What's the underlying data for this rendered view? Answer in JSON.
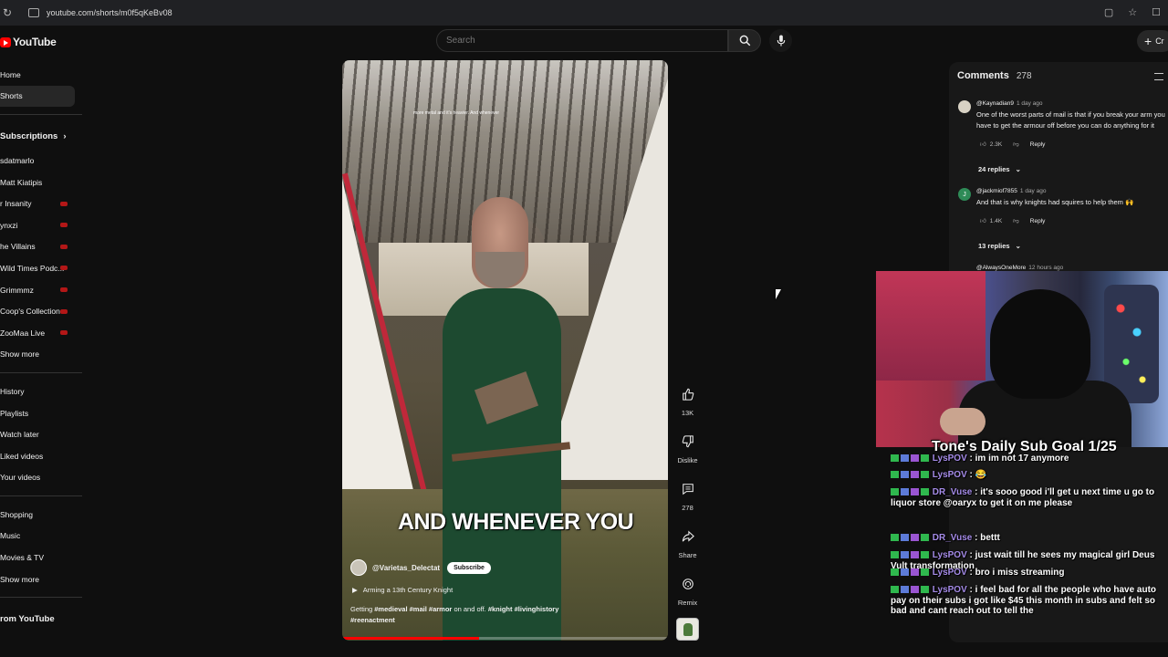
{
  "browser": {
    "url": "youtube.com/shorts/m0f5qKeBv08"
  },
  "topbar": {
    "logo_text": "YouTube",
    "search_placeholder": "Search",
    "create_label": "Cr"
  },
  "sidebar": {
    "main": [
      {
        "label": "Home",
        "active": false
      },
      {
        "label": "Shorts",
        "active": true
      }
    ],
    "subscriptions_header": "Subscriptions",
    "subscriptions": [
      {
        "label": "sdatmarlo",
        "live": false
      },
      {
        "label": "Matt Kiatipis",
        "live": false
      },
      {
        "label": "r Insanity",
        "live": true
      },
      {
        "label": "ynxzi",
        "live": true
      },
      {
        "label": "he Villains",
        "live": true
      },
      {
        "label": "Wild Times Podc...",
        "live": true
      },
      {
        "label": "Grimmmz",
        "live": true
      },
      {
        "label": "Coop's Collection",
        "live": true
      },
      {
        "label": "ZooMaa Live",
        "live": true
      },
      {
        "label": "Show more",
        "live": false
      }
    ],
    "you": [
      {
        "label": "History"
      },
      {
        "label": "Playlists"
      },
      {
        "label": "Watch later"
      },
      {
        "label": "Liked videos"
      },
      {
        "label": "Your videos"
      }
    ],
    "explore": [
      {
        "label": "Shopping"
      },
      {
        "label": "Music"
      },
      {
        "label": "Movies & TV"
      },
      {
        "label": "Show more"
      }
    ],
    "more_header": "rom YouTube"
  },
  "short": {
    "overlay_note": "more metal and it's heavier. And whenever",
    "caption": "AND WHENEVER YOU",
    "channel": "@Varietas_Delectat",
    "subscribe_label": "Subscribe",
    "playlist": "Arming a 13th Century Knight",
    "description_plain": "Getting ",
    "tag1": "#medieval",
    "tag2": "#mail",
    "tag3": "#armor",
    "description_mid": " on and off. ",
    "tag4": "#knight",
    "tag5": "#livinghistory",
    "tag6": "#reenactment",
    "progress_fraction": 0.42
  },
  "actions": {
    "like_count": "13K",
    "dislike_label": "Dislike",
    "comments_count": "278",
    "share_label": "Share",
    "remix_label": "Remix"
  },
  "comments_panel": {
    "title": "Comments",
    "count": "278",
    "items": [
      {
        "initial": "",
        "author": "@Kaynadian9",
        "time": "1 day ago",
        "text": "One of the worst parts of mail is that if you break your arm you have to get the armour off before you can do anything for it",
        "likes": "2.3K",
        "reply_label": "Reply",
        "replies": "24 replies",
        "avatar_color": "#d8d2c4"
      },
      {
        "initial": "J",
        "author": "@jackmiof7855",
        "time": "1 day ago",
        "text": "And that is why knights had squires to help them 🙌",
        "likes": "1.4K",
        "reply_label": "Reply",
        "replies": "13 replies",
        "avatar_color": "#2e8b57"
      }
    ],
    "partial_author": "@AlwaysOneMore",
    "partial_time": "12 hours ago"
  },
  "stream_overlay": {
    "goal": "Tone's Daily Sub Goal 1/25",
    "chat": [
      {
        "name": "LysPOV",
        "name_color": "#a58be8",
        "msg": "im im not 17 anymore"
      },
      {
        "name": "LysPOV",
        "name_color": "#a58be8",
        "msg": "😂"
      },
      {
        "name": "DR_Vuse",
        "name_color": "#a58be8",
        "msg": "it's sooo good i'll get u next time u go to liquor store @oaryx to get it on me please"
      },
      {
        "name": "DR_Vuse",
        "name_color": "#a58be8",
        "msg": "bettt"
      },
      {
        "name": "LysPOV",
        "name_color": "#a58be8",
        "msg": "just wait till he sees my magical girl Deus Vult transformation"
      },
      {
        "name": "LysPOV",
        "name_color": "#a58be8",
        "msg": "bro i miss streaming"
      },
      {
        "name": "LysPOV",
        "name_color": "#a58be8",
        "msg": "i feel bad for all the people who have auto pay on their subs i got like $45 this month in subs and felt so bad and cant reach out to tell the"
      }
    ]
  },
  "colors": {
    "accent": "#ff0000",
    "background": "#0f0f0f",
    "live_badge": "#b31717"
  }
}
